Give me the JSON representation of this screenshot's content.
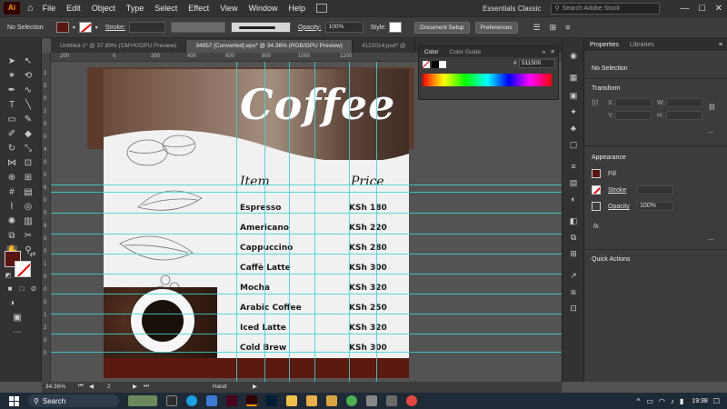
{
  "menubar": {
    "items": [
      "File",
      "Edit",
      "Object",
      "Type",
      "Select",
      "Effect",
      "View",
      "Window",
      "Help"
    ],
    "workspace": "Essentials Classic",
    "search_placeholder": "Search Adobe Stock"
  },
  "controlbar": {
    "selection": "No Selection",
    "stroke_label": "Stroke:",
    "opacity_label": "Opacity:",
    "opacity_value": "100%",
    "style_label": "Style:",
    "document_setup": "Document Setup",
    "preferences": "Preferences",
    "fill_color": "#5a1410"
  },
  "tabs": [
    "Untitled-1* @ 37.89% (CMYK/GPU Preview)",
    "34857 [Converted].eps* @ 34.36% (RGB/GPU Preview)",
    "4122014.psd* @"
  ],
  "rulers": {
    "top": [
      "200",
      "0",
      "200",
      "400",
      "600",
      "800",
      "1000",
      "1200"
    ],
    "left": [
      "2",
      "0",
      "0",
      "2",
      "0",
      "0",
      "4",
      "0",
      "0",
      "6",
      "0",
      "0",
      "8",
      "0",
      "0",
      "1",
      "0",
      "0",
      "0",
      "1",
      "2",
      "0",
      "0"
    ]
  },
  "artboard": {
    "title": "Coffee",
    "header_item": "Item",
    "header_price": "Price",
    "items": [
      {
        "name": "Espresso",
        "price": "KSh 180"
      },
      {
        "name": "Americano",
        "price": "KSh 220"
      },
      {
        "name": "Cappuccino",
        "price": "KSh 280"
      },
      {
        "name": "Caffè Latte",
        "price": "KSh 300"
      },
      {
        "name": "Mocha",
        "price": "KSh 320"
      },
      {
        "name": "Arabic Coffee",
        "price": "KSh 250"
      },
      {
        "name": "Iced Latte",
        "price": "KSh 320"
      },
      {
        "name": "Cold Brew",
        "price": "KSh 300"
      }
    ],
    "brown": "#5a2a1c",
    "dark_red": "#5b1a10"
  },
  "colorpanel": {
    "tab_color": "Color",
    "tab_guide": "Color Guide",
    "hex": "511500"
  },
  "properties": {
    "tab_properties": "Properties",
    "tab_libraries": "Libraries",
    "selection": "No Selection",
    "transform": "Transform",
    "x_label": "X:",
    "y_label": "Y:",
    "w_label": "W:",
    "h_label": "H:",
    "appearance": "Appearance",
    "fill": "Fill",
    "stroke": "Stroke",
    "opacity": "Opacity",
    "opacity_value": "100%",
    "fx": "fx.",
    "quick_actions": "Quick Actions"
  },
  "statusbar": {
    "zoom": "34.36%",
    "page": "2",
    "tool": "Hand"
  },
  "taskbar": {
    "search": "Search",
    "time": "19:38"
  }
}
